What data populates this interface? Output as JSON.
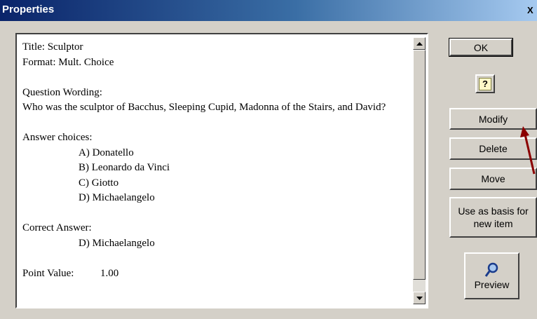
{
  "window": {
    "title": "Properties",
    "close_label": "X"
  },
  "content": {
    "lines": [
      "Title:  Sculptor",
      "Format:   Mult. Choice",
      "",
      "Question Wording:",
      "Who was the sculptor of Bacchus, Sleeping Cupid, Madonna of the Stairs, and David?",
      "",
      "Answer choices:",
      "A) Donatello",
      "B) Leonardo da Vinci",
      "C) Giotto",
      "D) Michaelangelo",
      "",
      "Correct Answer:",
      "D) Michaelangelo",
      "",
      "Point Value:          1.00"
    ]
  },
  "buttons": {
    "ok": "OK",
    "help": "?",
    "modify": "Modify",
    "delete": "Delete",
    "move": "Move",
    "use_as_basis": "Use as basis for new item",
    "preview": "Preview"
  },
  "colors": {
    "titlebar_start": "#0a246a",
    "titlebar_end": "#a6caf0",
    "arrow": "#8b0000"
  }
}
